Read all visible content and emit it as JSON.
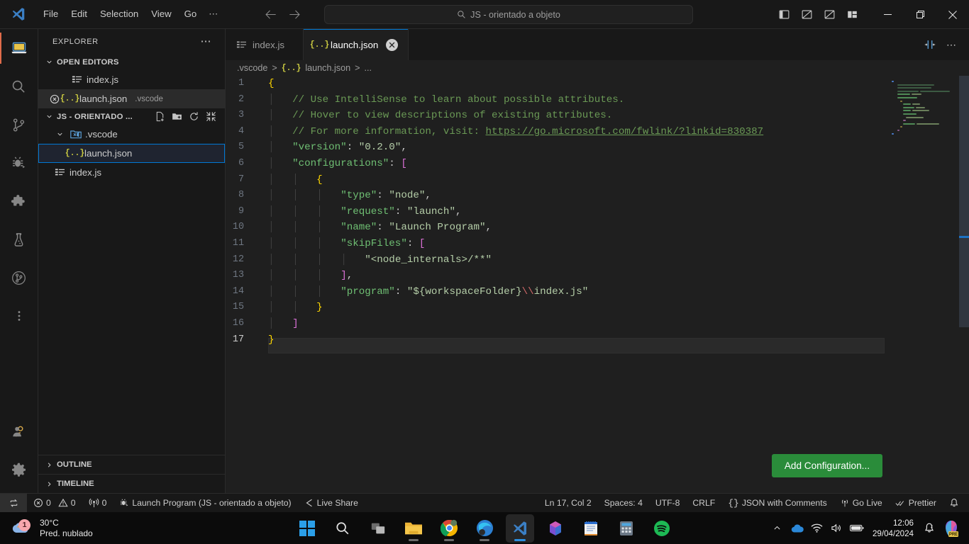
{
  "titlebar": {
    "logo_icon": "vscode-logo-icon",
    "menus": [
      "File",
      "Edit",
      "Selection",
      "View",
      "Go",
      "⋯"
    ],
    "nav_back_icon": "arrow-left-icon",
    "nav_forward_icon": "arrow-right-icon",
    "search": {
      "icon": "search-icon",
      "value": "JS - orientado a objeto",
      "placeholder": "Search"
    },
    "layout_icons": [
      "toggle-primary-sidebar-icon",
      "toggle-panel-icon",
      "toggle-secondary-sidebar-icon",
      "customize-layout-icon"
    ],
    "window_controls": [
      "minimize-icon",
      "restore-icon",
      "close-icon"
    ]
  },
  "activitybar": {
    "items": [
      {
        "name": "explorer",
        "icon": "files-explorer-icon",
        "active": true
      },
      {
        "name": "search",
        "icon": "search-icon",
        "active": false
      },
      {
        "name": "source-control",
        "icon": "source-control-branch-icon",
        "active": false
      },
      {
        "name": "run-and-debug",
        "icon": "run-debug-bug-icon",
        "active": false
      },
      {
        "name": "extensions",
        "icon": "extensions-puzzle-icon",
        "active": false
      },
      {
        "name": "testing",
        "icon": "testing-beaker-icon",
        "active": false
      },
      {
        "name": "git-graph",
        "icon": "git-graph-circle-icon",
        "active": false
      },
      {
        "name": "more-views",
        "icon": "more-vertical-dots-icon",
        "active": false
      }
    ],
    "bottom": [
      {
        "name": "accounts",
        "icon": "accounts-person-icon"
      },
      {
        "name": "manage-settings",
        "icon": "gear-icon"
      }
    ]
  },
  "sidebar": {
    "title": "EXPLORER",
    "title_more_icon": "more-horizontal-icon",
    "open_editors": {
      "label": "OPEN EDITORS",
      "chevron": "chevron-down-icon",
      "items": [
        {
          "label": "index.js",
          "icon": "js-file-icon",
          "suffix": "",
          "dirty": false,
          "selected": false
        },
        {
          "label": "launch.json",
          "icon": "json-file-icon",
          "suffix": ".vscode",
          "dirty": true,
          "selected": true
        }
      ]
    },
    "workspace": {
      "label": "JS - ORIENTADO ...",
      "chevron": "chevron-down-icon",
      "actions": [
        "new-file-icon",
        "new-folder-icon",
        "refresh-icon",
        "collapse-all-icon"
      ],
      "tree": [
        {
          "label": ".vscode",
          "icon": "vscode-folder-icon",
          "type": "folder",
          "chevron": "chevron-down-icon",
          "depth": 1
        },
        {
          "label": "launch.json",
          "icon": "json-file-icon",
          "type": "file",
          "depth": 2,
          "focused": true
        },
        {
          "label": "index.js",
          "icon": "js-file-icon",
          "type": "file",
          "depth": 1
        }
      ]
    },
    "bottom_sections": [
      {
        "label": "OUTLINE",
        "chevron": "chevron-right-icon"
      },
      {
        "label": "TIMELINE",
        "chevron": "chevron-right-icon"
      }
    ]
  },
  "editor": {
    "tabs": [
      {
        "label": "index.js",
        "icon": "js-file-icon",
        "active": false,
        "closable": false
      },
      {
        "label": "launch.json",
        "icon": "json-file-icon",
        "active": true,
        "closable": true,
        "close_icon": "close-dirty-icon"
      }
    ],
    "tab_actions": [
      "split-editor-icon",
      "more-actions-icon"
    ],
    "breadcrumb": [
      ".vscode",
      "launch.json",
      "..."
    ],
    "breadcrumb_separator": ">",
    "breadcrumb_file_icon": "json-file-icon",
    "add_configuration_button": "Add Configuration...",
    "add_configuration_color": "#2a8c3a",
    "lines": [
      {
        "n": 1,
        "text": "{"
      },
      {
        "n": 2,
        "text": "    // Use IntelliSense to learn about possible attributes."
      },
      {
        "n": 3,
        "text": "    // Hover to view descriptions of existing attributes."
      },
      {
        "n": 4,
        "text": "    // For more information, visit: https://go.microsoft.com/fwlink/?linkid=830387"
      },
      {
        "n": 5,
        "text": "    \"version\": \"0.2.0\","
      },
      {
        "n": 6,
        "text": "    \"configurations\": ["
      },
      {
        "n": 7,
        "text": "        {"
      },
      {
        "n": 8,
        "text": "            \"type\": \"node\","
      },
      {
        "n": 9,
        "text": "            \"request\": \"launch\","
      },
      {
        "n": 10,
        "text": "            \"name\": \"Launch Program\","
      },
      {
        "n": 11,
        "text": "            \"skipFiles\": ["
      },
      {
        "n": 12,
        "text": "                \"<node_internals>/**\""
      },
      {
        "n": 13,
        "text": "            ],"
      },
      {
        "n": 14,
        "text": "            \"program\": \"${workspaceFolder}\\\\index.js\""
      },
      {
        "n": 15,
        "text": "        }"
      },
      {
        "n": 16,
        "text": "    ]"
      },
      {
        "n": 17,
        "text": "}"
      }
    ],
    "link_url": "https://go.microsoft.com/fwlink/?linkid=830387"
  },
  "statusbar": {
    "remote_icon": "remote-window-icon",
    "problems": {
      "error_icon": "error-circle-icon",
      "errors": "0",
      "warning_icon": "warning-triangle-icon",
      "warnings": "0"
    },
    "ports": {
      "icon": "radio-tower-icon",
      "count": "0"
    },
    "debug_target": {
      "icon": "debug-alt-icon",
      "label": "Launch Program (JS - orientado a objeto)"
    },
    "live_share": {
      "icon": "live-share-icon",
      "label": "Live Share"
    },
    "right": [
      {
        "name": "cursor-position",
        "label": "Ln 17, Col 2"
      },
      {
        "name": "indentation",
        "label": "Spaces: 4"
      },
      {
        "name": "encoding",
        "label": "UTF-8"
      },
      {
        "name": "eol",
        "label": "CRLF"
      },
      {
        "name": "language-mode",
        "label": "JSON with Comments",
        "icon": "braces-icon"
      },
      {
        "name": "go-live",
        "label": "Go Live",
        "icon": "broadcast-icon"
      },
      {
        "name": "prettier",
        "label": "Prettier",
        "icon": "check-check-icon"
      },
      {
        "name": "notifications",
        "label": "",
        "icon": "bell-icon"
      }
    ]
  },
  "taskbar": {
    "weather": {
      "temperature": "30°C",
      "condition": "Pred. nublado",
      "badge": "1",
      "icon": "cloud-icon"
    },
    "apps": [
      {
        "name": "start",
        "icon": "windows-start-icon",
        "running": false,
        "active": false
      },
      {
        "name": "search",
        "icon": "search-icon",
        "running": false,
        "active": false
      },
      {
        "name": "task-view",
        "icon": "task-view-icon",
        "running": false,
        "active": false
      },
      {
        "name": "file-explorer",
        "icon": "file-explorer-icon",
        "running": true,
        "active": false
      },
      {
        "name": "google-chrome",
        "icon": "chrome-icon",
        "running": true,
        "active": false
      },
      {
        "name": "microsoft-edge",
        "icon": "edge-icon",
        "running": true,
        "active": false
      },
      {
        "name": "visual-studio-code",
        "icon": "vscode-icon",
        "running": true,
        "active": true
      },
      {
        "name": "microsoft-365",
        "icon": "office-icon",
        "running": false,
        "active": false
      },
      {
        "name": "notepad",
        "icon": "notepad-icon",
        "running": false,
        "active": false
      },
      {
        "name": "calculator",
        "icon": "calculator-icon",
        "running": false,
        "active": false
      },
      {
        "name": "spotify",
        "icon": "spotify-icon",
        "running": false,
        "active": false
      }
    ],
    "tray": {
      "overflow_icon": "chevron-up-icon",
      "onedrive_icon": "onedrive-cloud-icon",
      "wifi_icon": "wifi-icon",
      "volume_icon": "speaker-icon",
      "battery_icon": "battery-icon",
      "notification_icon": "bell-silent-icon",
      "copilot_icon": "copilot-pre-icon",
      "copilot_badge": "PRE",
      "time": "12:06",
      "date": "29/04/2024"
    }
  }
}
